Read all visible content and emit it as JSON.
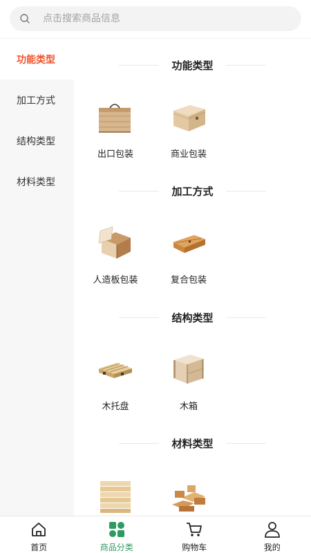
{
  "search": {
    "placeholder": "点击搜索商品信息",
    "icon": "search-icon"
  },
  "sidebar": {
    "items": [
      {
        "label": "功能类型",
        "active": true
      },
      {
        "label": "加工方式",
        "active": false
      },
      {
        "label": "结构类型",
        "active": false
      },
      {
        "label": "材料类型",
        "active": false
      }
    ]
  },
  "sections": [
    {
      "title": "功能类型",
      "products": [
        {
          "label": "出口包装",
          "icon": "export-box-icon"
        },
        {
          "label": "商业包装",
          "icon": "gift-box-icon"
        }
      ]
    },
    {
      "title": "加工方式",
      "products": [
        {
          "label": "人造板包装",
          "icon": "plywood-crate-icon"
        },
        {
          "label": "复合包装",
          "icon": "wine-box-icon"
        }
      ]
    },
    {
      "title": "结构类型",
      "products": [
        {
          "label": "木托盘",
          "icon": "pallet-icon"
        },
        {
          "label": "木箱",
          "icon": "wooden-case-icon"
        }
      ]
    },
    {
      "title": "材料类型",
      "products": [
        {
          "label": "",
          "icon": "board-stack-icon"
        },
        {
          "label": "",
          "icon": "lumber-pile-icon"
        }
      ]
    }
  ],
  "tabbar": {
    "items": [
      {
        "label": "首页",
        "icon": "home-icon",
        "active": false
      },
      {
        "label": "商品分类",
        "icon": "category-icon",
        "active": true
      },
      {
        "label": "购物车",
        "icon": "cart-icon",
        "active": false
      },
      {
        "label": "我的",
        "icon": "user-icon",
        "active": false
      }
    ]
  },
  "colors": {
    "accent_active_sidebar": "#f0542d",
    "accent_tab": "#2e9b63",
    "sidebar_bg": "#f7f7f7",
    "search_bg": "#f3f3f3"
  }
}
